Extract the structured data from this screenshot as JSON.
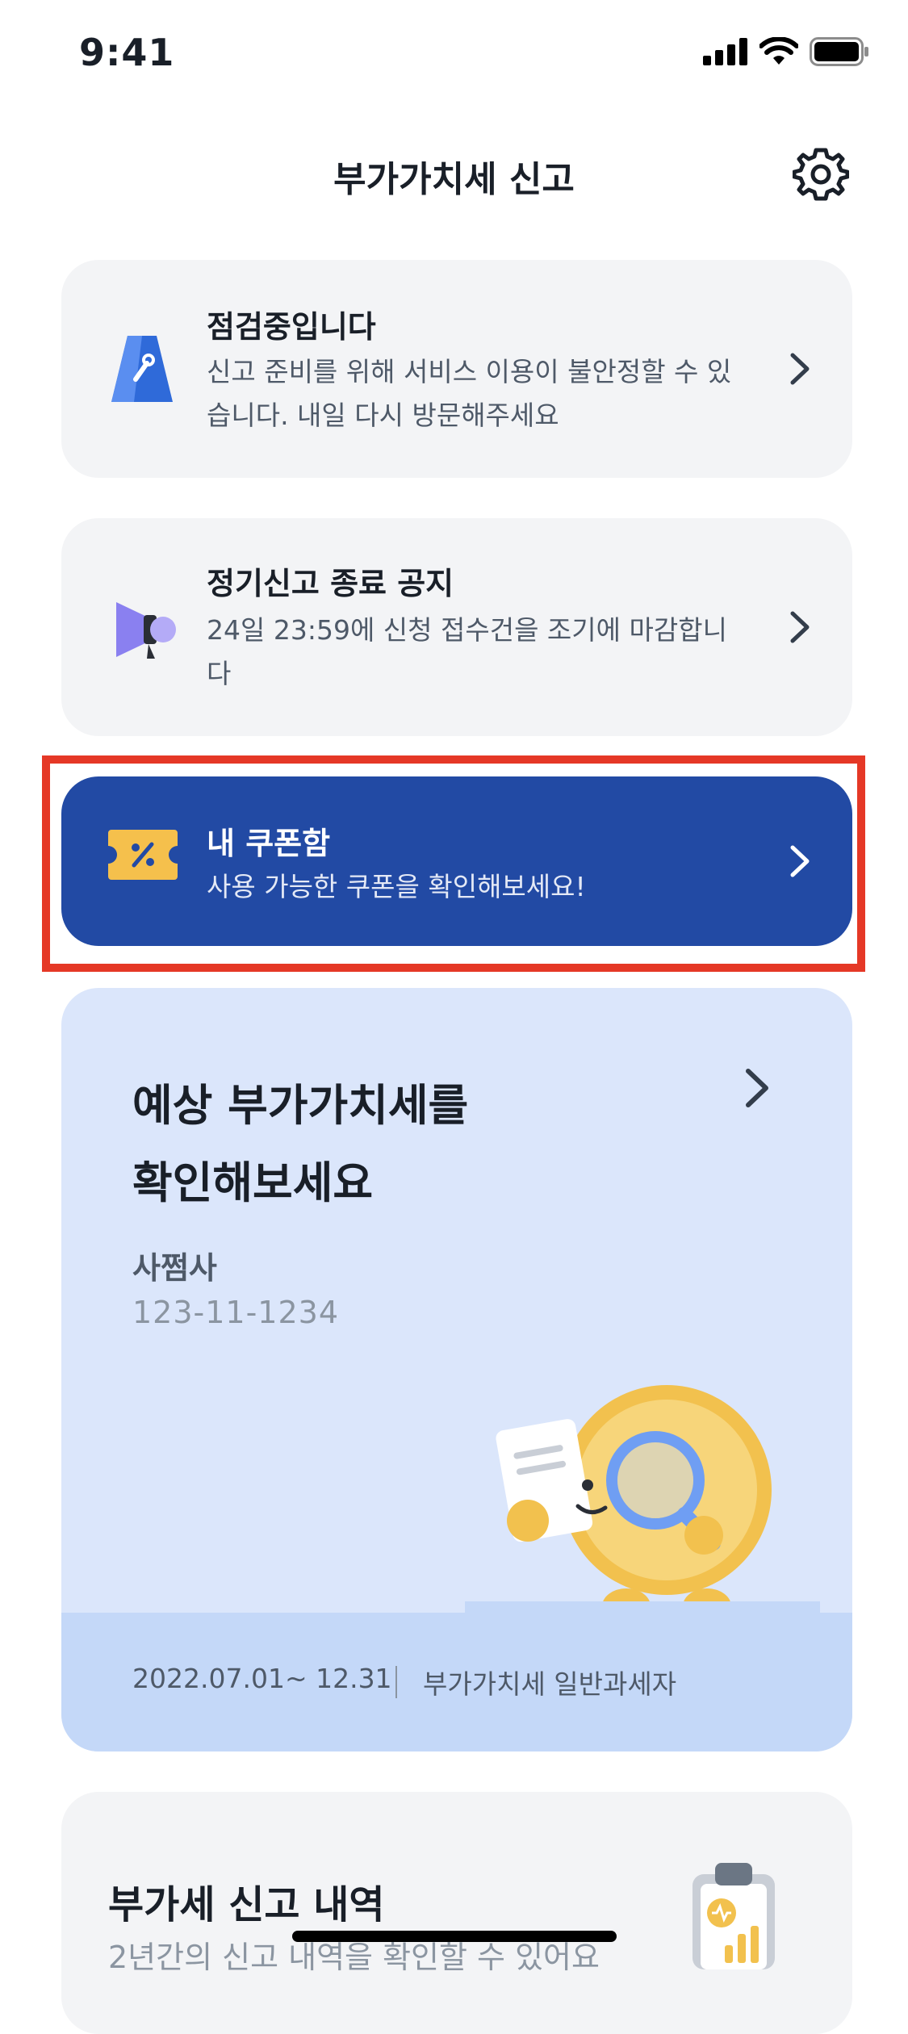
{
  "status_bar": {
    "time": "9:41"
  },
  "header": {
    "title": "부가가치세 신고"
  },
  "maintenance_card": {
    "title": "점검중입니다",
    "description_line1": "신고 준비를 위해 서비스 이용이 불안정할 수 있",
    "description_line2": "습니다. 내일 다시 방문해주세요"
  },
  "notice_card": {
    "title": "정기신고 종료 공지",
    "description_line1": "24일 23:59에 신청 접수건을 조기에 마감합니",
    "description_line2": "다"
  },
  "coupon_card": {
    "title": "내 쿠폰함",
    "description": "사용 가능한 쿠폰을 확인해보세요!"
  },
  "estimate_card": {
    "title_line1": "예상 부가가치세를",
    "title_line2": "확인해보세요",
    "company_name": "사쩜사",
    "business_number": "123-11-1234",
    "period": "2022.07.01~ 12.31",
    "taxpayer_type": "부가가치세 일반과세자"
  },
  "history_card": {
    "title": "부가세 신고 내역",
    "description": "2년간의 신고 내역을 확인할 수 있어요"
  },
  "colors": {
    "coupon_bg": "#224aa4",
    "highlight_border": "#e53826",
    "estimate_bg": "#dbe6fb",
    "card_bg": "#f3f4f6"
  }
}
